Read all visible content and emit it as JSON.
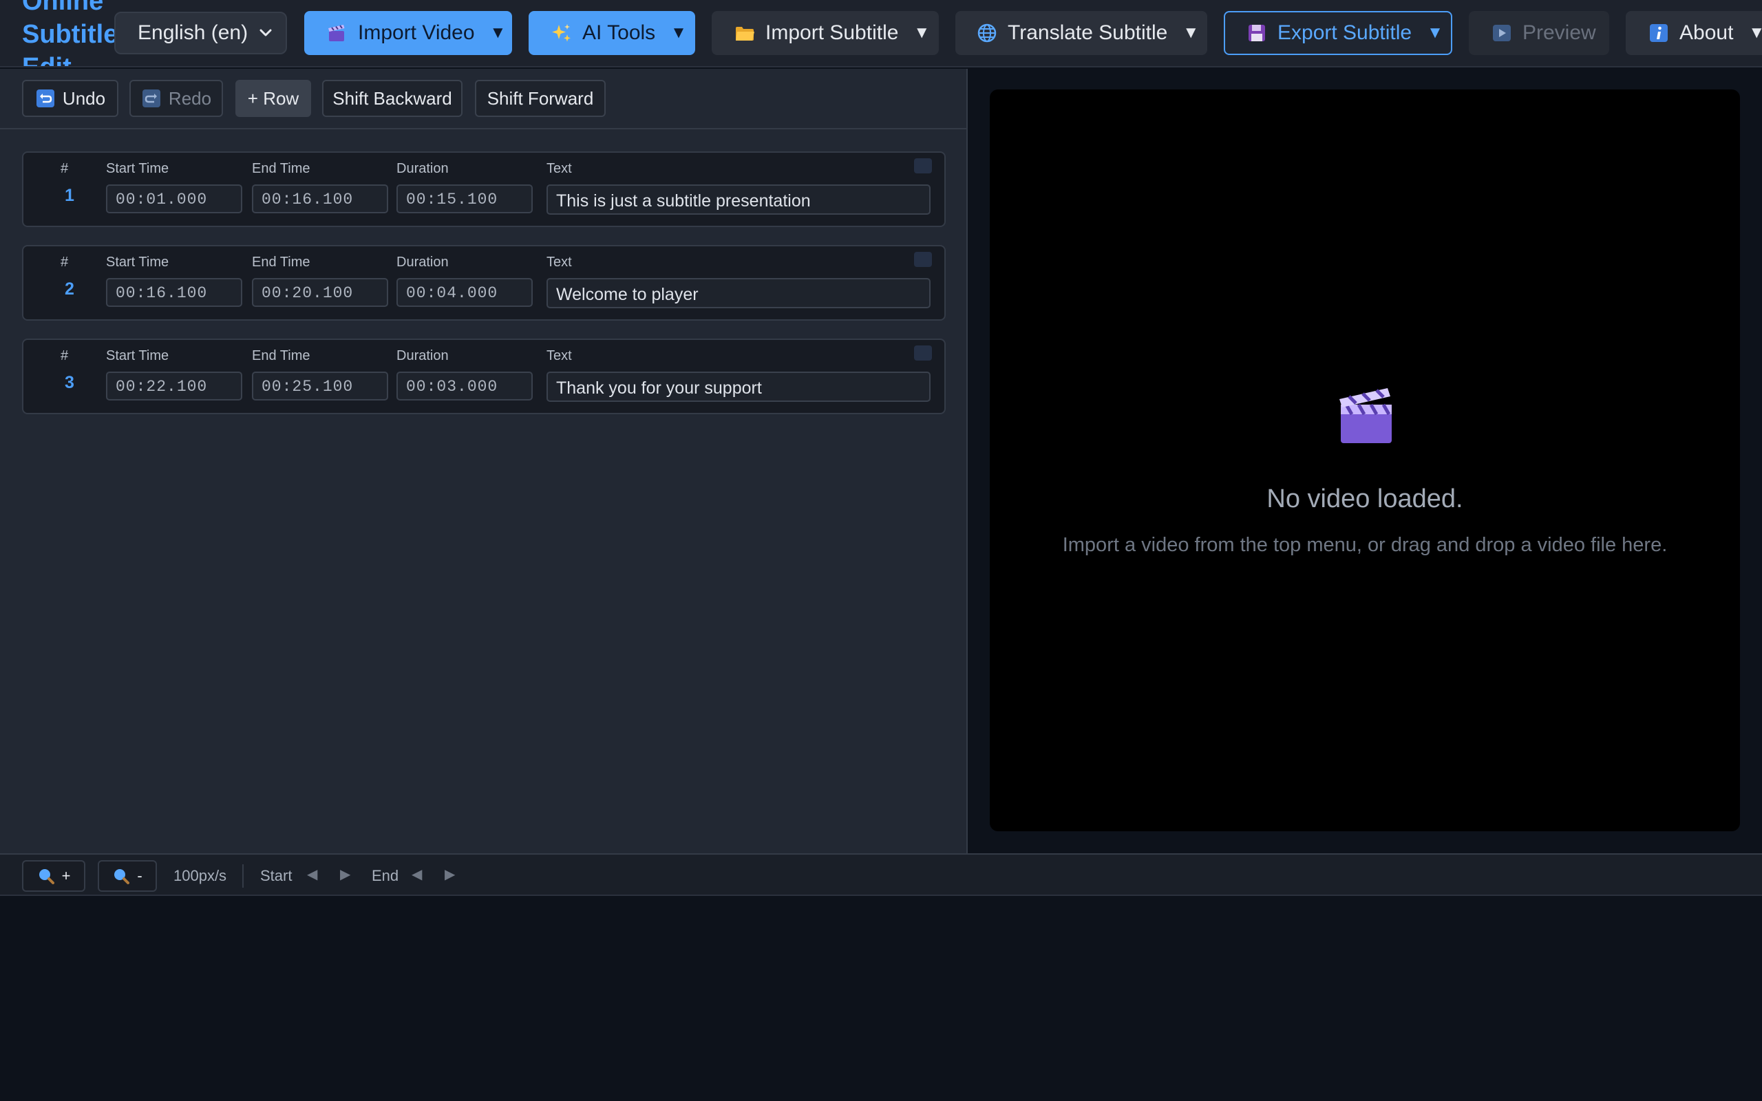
{
  "app": {
    "title_lines": [
      "Online",
      "Subtitle",
      "Edit"
    ]
  },
  "topbar": {
    "language": "English (en)",
    "import_video": "Import Video",
    "ai_tools": "AI Tools",
    "import_subtitle": "Import Subtitle",
    "translate_subtitle": "Translate Subtitle",
    "export_subtitle": "Export Subtitle",
    "preview": "Preview",
    "about": "About",
    "caret": "▼"
  },
  "toolbar": {
    "undo": "Undo",
    "redo": "Redo",
    "add_row": "+ Row",
    "shift_backward": "Shift Backward",
    "shift_forward": "Shift Forward"
  },
  "columns": {
    "index": "#",
    "start": "Start Time",
    "end": "End Time",
    "duration": "Duration",
    "text": "Text"
  },
  "rows": [
    {
      "index": "1",
      "start": "00:01.000",
      "end": "00:16.100",
      "duration": "00:15.100",
      "text": "This is just a subtitle presentation"
    },
    {
      "index": "2",
      "start": "00:16.100",
      "end": "00:20.100",
      "duration": "00:04.000",
      "text": "Welcome to player"
    },
    {
      "index": "3",
      "start": "00:22.100",
      "end": "00:25.100",
      "duration": "00:03.000",
      "text": "Thank you for your support"
    }
  ],
  "video": {
    "empty_title": "No video loaded.",
    "empty_hint": "Import a video from the top menu, or drag and drop a video file here."
  },
  "timeline": {
    "zoom_in": "+",
    "zoom_out": "-",
    "scale": "100px/s",
    "start_label": "Start",
    "end_label": "End",
    "prev_arrow": "◀",
    "next_arrow": "▶"
  },
  "colors": {
    "accent": "#4c9ef8",
    "background": "#0d121b",
    "panel": "#222833"
  },
  "icons": {
    "import_video": "clapper-icon",
    "ai_tools": "sparkles-icon",
    "import_subtitle": "folder-icon",
    "translate_subtitle": "globe-icon",
    "export_subtitle": "floppy-disk-icon",
    "preview": "play-icon",
    "about": "info-icon",
    "undo": "undo-icon",
    "redo": "redo-icon",
    "zoom": "magnifier-icon"
  }
}
